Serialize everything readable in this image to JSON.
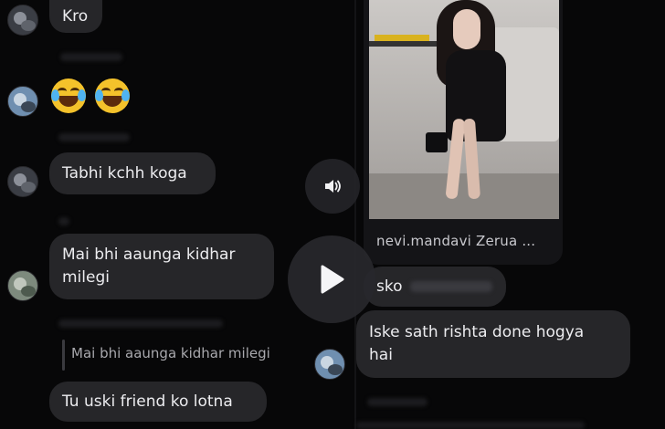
{
  "left_chat": {
    "top_bubble": "Kro",
    "emoji_1": "😂",
    "emoji_2": "😂",
    "msg_tabhi": "Tabhi kchh koga",
    "msg_mai_line1": "Mai bhi aaunga kidhar",
    "msg_mai_line2": "milegi",
    "reply_quote": "Mai bhi aaunga kidhar milegi",
    "msg_tu": "Tu uski friend ko lotna"
  },
  "right_chat": {
    "post_caption": "nevi.mandavi Zerua ...",
    "msg_sko": "sko",
    "msg_rishta_line1": "Iske sath rishta done hogya",
    "msg_rishta_line2": "hai"
  },
  "video_controls": {
    "volume_icon": "speaker-icon",
    "play_icon": "play-icon"
  },
  "colors": {
    "background": "#070708",
    "bubble": "#262629",
    "text": "#ececef"
  }
}
